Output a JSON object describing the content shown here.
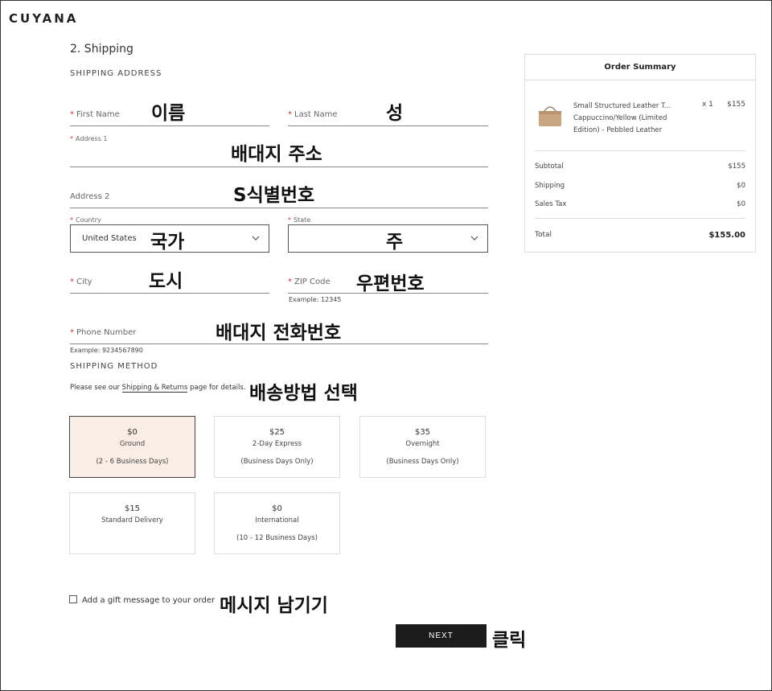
{
  "brand": "CUYANA",
  "section_title": "2. Shipping",
  "shipping_address_heading": "SHIPPING ADDRESS",
  "fields": {
    "first_name": {
      "label": "First Name",
      "annotation": "이름"
    },
    "last_name": {
      "label": "Last Name",
      "annotation": "성"
    },
    "address1": {
      "label": "Address 1",
      "annotation": "배대지 주소"
    },
    "address2": {
      "label": "Address 2",
      "annotation": "S식별번호"
    },
    "country": {
      "label": "Country",
      "value": "United States",
      "annotation": "국가"
    },
    "state": {
      "label": "State",
      "value": "",
      "annotation": "주"
    },
    "city": {
      "label": "City",
      "annotation": "도시"
    },
    "zip": {
      "label": "ZIP Code",
      "hint": "Example: 12345",
      "annotation": "우편번호"
    },
    "phone": {
      "label": "Phone Number",
      "hint": "Example: 9234567890",
      "annotation": "배대지 전화번호"
    }
  },
  "shipping_method_heading": "SHIPPING METHOD",
  "shipping_note": {
    "prefix": "Please see our ",
    "link": "Shipping & Returns",
    "suffix": " page for details.",
    "annotation": "배송방법 선택"
  },
  "shipping_options": [
    {
      "price": "$0",
      "name": "Ground",
      "days": "(2 - 6 Business Days)",
      "selected": true
    },
    {
      "price": "$25",
      "name": "2-Day Express",
      "days": "(Business Days Only)",
      "selected": false
    },
    {
      "price": "$35",
      "name": "Overnight",
      "days": "(Business Days Only)",
      "selected": false
    },
    {
      "price": "$15",
      "name": "Standard Delivery",
      "days": "",
      "selected": false
    },
    {
      "price": "$0",
      "name": "International",
      "days": "(10 - 12 Business Days)",
      "selected": false
    }
  ],
  "gift": {
    "label": "Add a gift message to your order",
    "annotation": "메시지 남기기"
  },
  "next": {
    "label": "NEXT",
    "annotation": "클릭"
  },
  "order_summary": {
    "title": "Order Summary",
    "product": {
      "name": "Small Structured Leather T... Cappuccino/Yellow (Limited Edition) - Pebbled Leather",
      "qty": "x 1",
      "price": "$155"
    },
    "subtotal": {
      "label": "Subtotal",
      "value": "$155"
    },
    "shipping": {
      "label": "Shipping",
      "value": "$0"
    },
    "tax": {
      "label": "Sales Tax",
      "value": "$0"
    },
    "total": {
      "label": "Total",
      "value": "$155.00"
    }
  },
  "colors": {
    "selected_option_bg": "#f9ede6",
    "button_bg": "#1c1c1c",
    "required": "#cc3333"
  }
}
